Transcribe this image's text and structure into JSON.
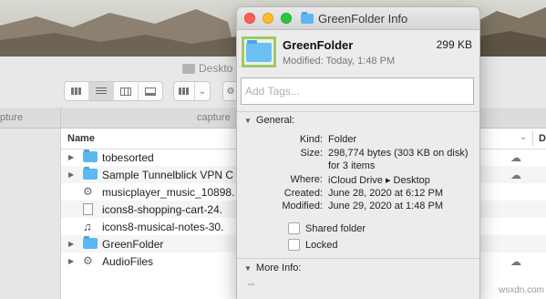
{
  "finder": {
    "title": "Deskto",
    "tab_left": "pture",
    "tab_capture": "capture",
    "column_name": "Name",
    "column_second": "D",
    "rows": [
      {
        "name": "tobesorted",
        "type": "folder",
        "expandable": true,
        "cloud": true
      },
      {
        "name": "Sample Tunnelblick VPN C",
        "type": "folder",
        "expandable": true,
        "cloud": true
      },
      {
        "name": "musicplayer_music_10898.",
        "type": "gear",
        "expandable": false,
        "cloud": false
      },
      {
        "name": "icons8-shopping-cart-24.",
        "type": "doc",
        "expandable": false,
        "cloud": false
      },
      {
        "name": "icons8-musical-notes-30.",
        "type": "music",
        "expandable": false,
        "cloud": false
      },
      {
        "name": "GreenFolder",
        "type": "folder",
        "expandable": true,
        "cloud": false
      },
      {
        "name": "AudioFiles",
        "type": "gear",
        "expandable": true,
        "cloud": true
      }
    ]
  },
  "info": {
    "window_title": "GreenFolder Info",
    "name": "GreenFolder",
    "size": "299 KB",
    "modified_summary": "Modified: Today, 1:48 PM",
    "tags_placeholder": "Add Tags...",
    "general_label": "General:",
    "kind_label": "Kind:",
    "kind_value": "Folder",
    "size_label": "Size:",
    "size_value": "298,774 bytes (303 KB on disk)",
    "size_value_2": "for 3 items",
    "where_label": "Where:",
    "where_value": "iCloud Drive ▸ Desktop",
    "created_label": "Created:",
    "created_value": "June 28, 2020 at 6:12 PM",
    "modified_label": "Modified:",
    "modified_value": "June 29, 2020 at 1:48 PM",
    "shared_folder_label": "Shared folder",
    "locked_label": "Locked",
    "more_info_label": "More Info:",
    "more_info_value": "--",
    "highlight_color": "#9cc96a"
  },
  "watermark": "wsxdn.com"
}
